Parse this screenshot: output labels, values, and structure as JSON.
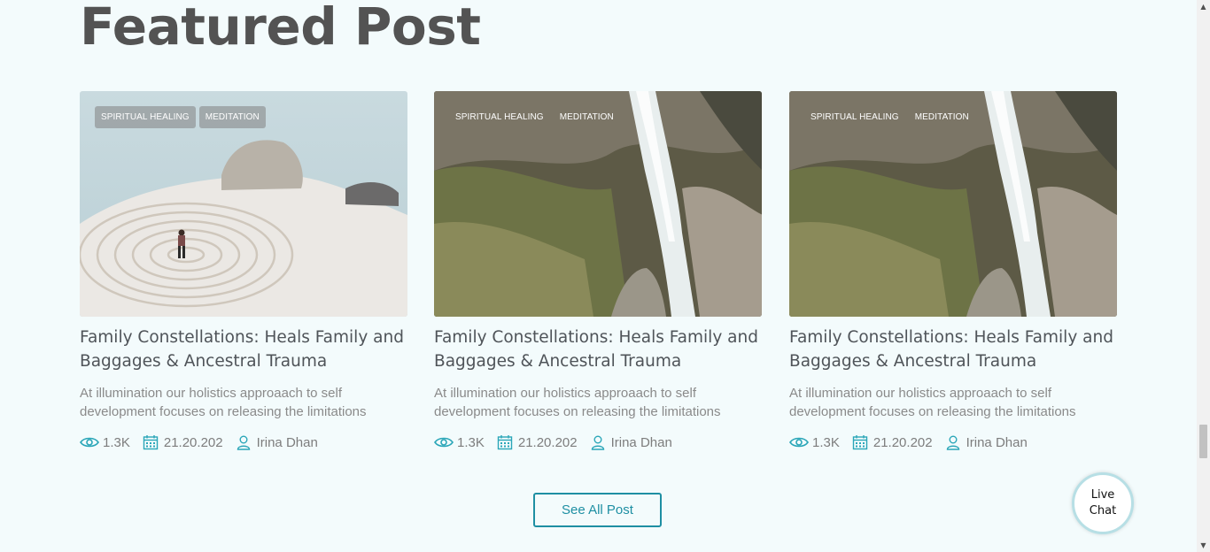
{
  "section": {
    "title": "Featured Post"
  },
  "posts": [
    {
      "tags": [
        "SPIRITUAL HEALING",
        "MEDITATION"
      ],
      "image": "labyrinth-beach-image",
      "title": "Family Constellations: Heals Family and Baggages & Ancestral Trauma",
      "excerpt": "At illumination our holistics approaach to self development focuses on releasing the limitations",
      "views": "1.3K",
      "date": "21.20.202",
      "author": "Irina Dhan"
    },
    {
      "tags": [
        "SPIRITUAL HEALING",
        "MEDITATION"
      ],
      "image": "waterfall-image",
      "title": "Family Constellations: Heals Family and Baggages & Ancestral Trauma",
      "excerpt": "At illumination our holistics approaach to self development focuses on releasing the limitations",
      "views": "1.3K",
      "date": "21.20.202",
      "author": "Irina Dhan"
    },
    {
      "tags": [
        "SPIRITUAL HEALING",
        "MEDITATION"
      ],
      "image": "waterfall-image",
      "title": "Family Constellations: Heals Family and Baggages & Ancestral Trauma",
      "excerpt": "At illumination our holistics approaach to self development focuses on releasing the limitations",
      "views": "1.3K",
      "date": "21.20.202",
      "author": "Irina Dhan"
    }
  ],
  "see_all_label": "See All Post",
  "live_chat_label": "Live\nChat",
  "colors": {
    "accent": "#1e8fa3",
    "background": "#f3fbfc",
    "title": "#535353",
    "meta_icon": "#2aa6b8"
  },
  "icons": {
    "views": "eye-icon",
    "date": "calendar-icon",
    "author": "user-icon"
  }
}
